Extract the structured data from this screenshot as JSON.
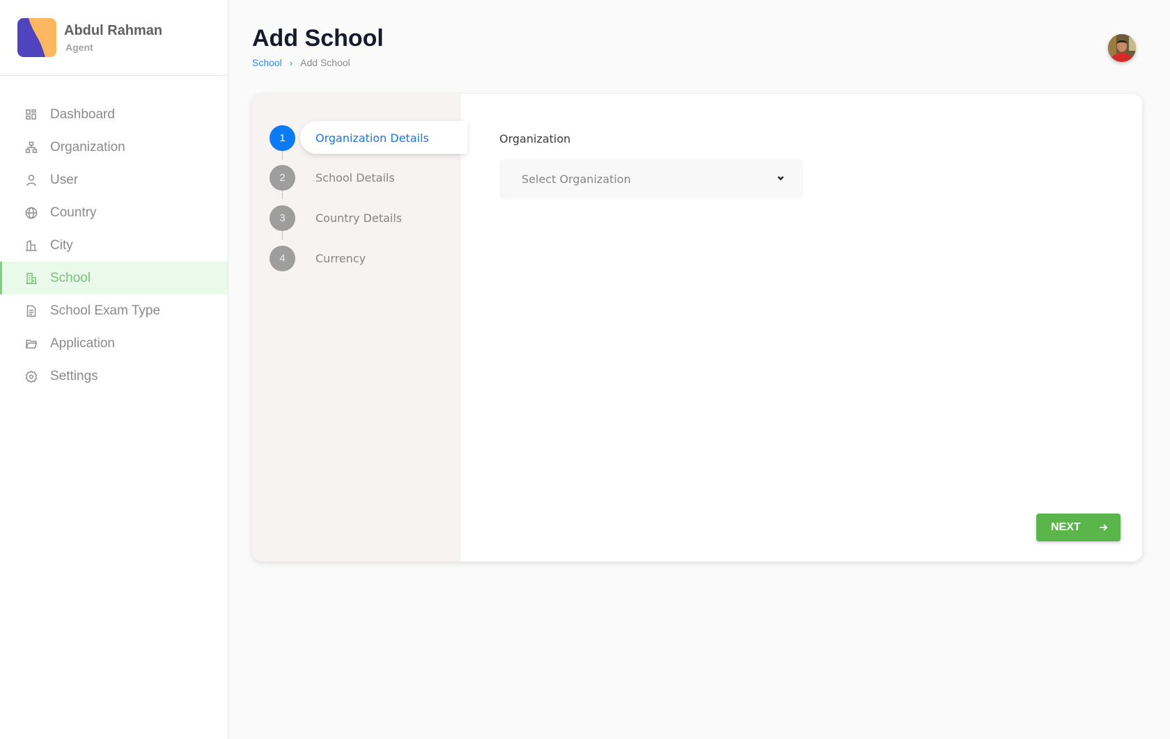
{
  "profile": {
    "name": "Abdul Rahman",
    "role": "Agent",
    "logo_colors": {
      "left": "#4f44bd",
      "right": "#fdb760"
    }
  },
  "sidebar": {
    "items": [
      {
        "label": "Dashboard",
        "icon": "dashboard-grid-icon",
        "active": false
      },
      {
        "label": "Organization",
        "icon": "org-chart-icon",
        "active": false
      },
      {
        "label": "User",
        "icon": "user-icon",
        "active": false
      },
      {
        "label": "Country",
        "icon": "globe-icon",
        "active": false
      },
      {
        "label": "City",
        "icon": "city-building-icon",
        "active": false
      },
      {
        "label": "School",
        "icon": "school-building-icon",
        "active": true
      },
      {
        "label": "School Exam Type",
        "icon": "document-icon",
        "active": false
      },
      {
        "label": "Application",
        "icon": "folder-icon",
        "active": false
      },
      {
        "label": "Settings",
        "icon": "gear-icon",
        "active": false
      }
    ],
    "active_color": "#7cbf7c",
    "active_bg": "#eafaea"
  },
  "header": {
    "title": "Add School",
    "breadcrumb": {
      "parent": "School",
      "separator": "›",
      "current": "Add School"
    }
  },
  "stepper": {
    "steps": [
      {
        "number": "1",
        "label": "Organization Details",
        "active": true
      },
      {
        "number": "2",
        "label": "School Details",
        "active": false
      },
      {
        "number": "3",
        "label": "Country Details",
        "active": false
      },
      {
        "number": "4",
        "label": "Currency",
        "active": false
      }
    ],
    "active_color": "#0b7bf5"
  },
  "form": {
    "organization_label": "Organization",
    "organization_placeholder": "Select Organization",
    "organization_value": ""
  },
  "actions": {
    "next_label": "NEXT",
    "next_color": "#5ab54b"
  }
}
